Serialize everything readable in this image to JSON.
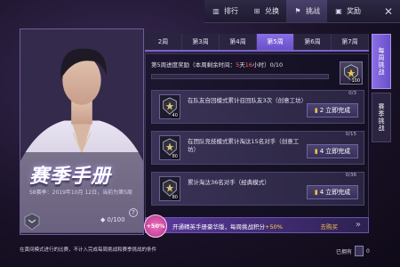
{
  "topbar": {
    "nav": [
      {
        "label": "排行",
        "icon": "ranking-icon",
        "active": false
      },
      {
        "label": "兑换",
        "icon": "exchange-icon",
        "active": false
      },
      {
        "label": "挑战",
        "icon": "challenge-icon",
        "active": true
      },
      {
        "label": "奖励",
        "icon": "reward-icon",
        "active": false
      }
    ],
    "close": "✕"
  },
  "card": {
    "title": "赛季手册",
    "subtitle": "S8赛季：2019年10月 12日，当前为第5周",
    "count": "0/100"
  },
  "week_tabs": [
    "2周",
    "第3周",
    "第4周",
    "第5周",
    "第6周",
    "第7周"
  ],
  "active_week_index": 3,
  "progress": {
    "prefix": "第5周进度奖励（本周剩余时间：",
    "days": "5",
    "days_unit": "天",
    "hours": "16",
    "hours_unit": "小时",
    "suffix": "）0/10",
    "fill_fraction": 0,
    "reward_value": "100"
  },
  "tasks": [
    {
      "text": "在队友自回模式累计召回队友3次（创意工坊）",
      "points": "40",
      "count": "0/3",
      "cost": "2",
      "action": "立即完成"
    },
    {
      "text": "在团队竞技模式累计淘汰15名对手（创意工坊）",
      "points": "80",
      "count": "0/15",
      "cost": "4",
      "action": "立即完成"
    },
    {
      "text": "累计淘汰36名对手（经典模式）",
      "points": "80",
      "count": "0/36",
      "cost": "4",
      "action": "立即完成"
    }
  ],
  "banner": {
    "badge": "+50%",
    "text_before": "开通精英手册豪华版，每周挑战积分",
    "text_plus": "+50%",
    "link": "去购买"
  },
  "footer_note": "在黄间模式进行的比赛，不计入完成每周挑战和赛季挑战的条件",
  "have_label": "已拥有",
  "have_count": "0",
  "side_tabs": [
    {
      "label": "每周挑战",
      "active": true
    },
    {
      "label": "赛季挑战",
      "active": false
    }
  ],
  "colors": {
    "accent": "#7a64c8",
    "gold": "#f5c04a",
    "red": "#ff6a6a",
    "pink": "#f071c0"
  }
}
